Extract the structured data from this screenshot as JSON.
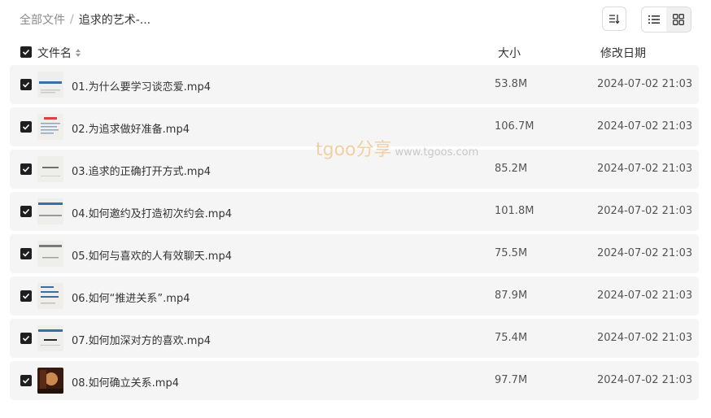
{
  "breadcrumb": {
    "root": "全部文件",
    "separator": "/",
    "current": "追求的艺术-..."
  },
  "toolbar": {
    "sort_icon": "sort-icon",
    "list_view_icon": "list-view-icon",
    "grid_view_icon": "grid-view-icon"
  },
  "header": {
    "name_label": "文件名",
    "size_label": "大小",
    "date_label": "修改日期",
    "all_checked": true
  },
  "files": [
    {
      "name": "01.为什么要学习谈恋爱.mp4",
      "size": "53.8M",
      "date": "2024-07-02 21:03",
      "checked": true,
      "thumb": "slide-blue"
    },
    {
      "name": "02.为追求做好准备.mp4",
      "size": "106.7M",
      "date": "2024-07-02 21:03",
      "checked": true,
      "thumb": "slide-red"
    },
    {
      "name": "03.追求的正确打开方式.mp4",
      "size": "85.2M",
      "date": "2024-07-02 21:03",
      "checked": true,
      "thumb": "slide-plain"
    },
    {
      "name": "04.如何邀约及打造初次约会.mp4",
      "size": "101.8M",
      "date": "2024-07-02 21:03",
      "checked": true,
      "thumb": "slide-blue"
    },
    {
      "name": "05.如何与喜欢的人有效聊天.mp4",
      "size": "75.5M",
      "date": "2024-07-02 21:03",
      "checked": true,
      "thumb": "slide-plain"
    },
    {
      "name": "06.如何“推进关系”.mp4",
      "size": "87.9M",
      "date": "2024-07-02 21:03",
      "checked": true,
      "thumb": "slide-blue"
    },
    {
      "name": "07.如何加深对方的喜欢.mp4",
      "size": "75.4M",
      "date": "2024-07-02 21:03",
      "checked": true,
      "thumb": "slide-dark"
    },
    {
      "name": "08.如何确立关系.mp4",
      "size": "97.7M",
      "date": "2024-07-02 21:03",
      "checked": true,
      "thumb": "photo"
    }
  ],
  "watermark": {
    "logo": "tgoo分享",
    "url": "www.tgoos.com"
  },
  "colors": {
    "checkbox": "#1f1f1f",
    "row_bg": "#f5f5f5",
    "watermark": "#f2cfa4"
  }
}
